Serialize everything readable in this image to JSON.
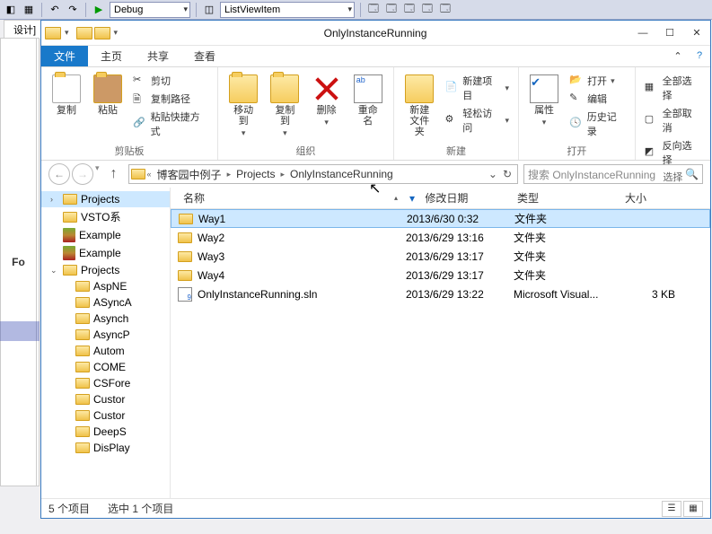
{
  "vs": {
    "config_combo": "Debug",
    "item_combo": "ListViewItem",
    "tab_design": "设计]",
    "label_fo": "Fo"
  },
  "window": {
    "title": "OnlyInstanceRunning"
  },
  "tabs": {
    "file": "文件",
    "home": "主页",
    "share": "共享",
    "view": "查看"
  },
  "ribbon": {
    "copy": "复制",
    "paste": "粘贴",
    "cut": "剪切",
    "copy_path": "复制路径",
    "paste_shortcut": "粘贴快捷方式",
    "group_clipboard": "剪贴板",
    "move_to": "移动到",
    "copy_to": "复制到",
    "delete": "删除",
    "rename": "重命名",
    "group_organize": "组织",
    "new_folder": "新建\n文件夹",
    "new_item": "新建项目",
    "easy_access": "轻松访问",
    "group_new": "新建",
    "properties": "属性",
    "open": "打开",
    "edit": "编辑",
    "history": "历史记录",
    "group_open": "打开",
    "select_all": "全部选择",
    "select_none": "全部取消",
    "invert_sel": "反向选择",
    "group_select": "选择"
  },
  "breadcrumb": [
    "博客园中例子",
    "Projects",
    "OnlyInstanceRunning"
  ],
  "search": {
    "placeholder": "搜索 OnlyInstanceRunning"
  },
  "columns": {
    "name": "名称",
    "date": "修改日期",
    "type": "类型",
    "size": "大小"
  },
  "sidebar": [
    {
      "label": "Projects",
      "icon": "folder",
      "indent": 0,
      "expandable": true,
      "selected": true
    },
    {
      "label": "VSTO系",
      "icon": "folder",
      "indent": 0
    },
    {
      "label": "Example",
      "icon": "rar",
      "indent": 0
    },
    {
      "label": "Example",
      "icon": "rar",
      "indent": 0
    },
    {
      "label": "Projects",
      "icon": "folder",
      "indent": 0,
      "expandable": true,
      "open": true
    },
    {
      "label": "AspNE",
      "icon": "folder",
      "indent": 1
    },
    {
      "label": "ASyncA",
      "icon": "folder",
      "indent": 1
    },
    {
      "label": "Asynch",
      "icon": "folder",
      "indent": 1
    },
    {
      "label": "AsyncP",
      "icon": "folder",
      "indent": 1
    },
    {
      "label": "Autom",
      "icon": "folder",
      "indent": 1
    },
    {
      "label": "COME",
      "icon": "folder",
      "indent": 1
    },
    {
      "label": "CSFore",
      "icon": "folder",
      "indent": 1
    },
    {
      "label": "Custor",
      "icon": "folder",
      "indent": 1
    },
    {
      "label": "Custor",
      "icon": "folder",
      "indent": 1
    },
    {
      "label": "DeepS",
      "icon": "folder",
      "indent": 1
    },
    {
      "label": "DisPlay",
      "icon": "folder",
      "indent": 1
    }
  ],
  "files": [
    {
      "name": "Way1",
      "date": "2013/6/30 0:32",
      "type": "文件夹",
      "size": "",
      "icon": "folder",
      "selected": true
    },
    {
      "name": "Way2",
      "date": "2013/6/29 13:16",
      "type": "文件夹",
      "size": "",
      "icon": "folder"
    },
    {
      "name": "Way3",
      "date": "2013/6/29 13:17",
      "type": "文件夹",
      "size": "",
      "icon": "folder"
    },
    {
      "name": "Way4",
      "date": "2013/6/29 13:17",
      "type": "文件夹",
      "size": "",
      "icon": "folder"
    },
    {
      "name": "OnlyInstanceRunning.sln",
      "date": "2013/6/29 13:22",
      "type": "Microsoft Visual...",
      "size": "3 KB",
      "icon": "sln"
    }
  ],
  "status": {
    "items": "5 个项目",
    "selected": "选中 1 个项目"
  }
}
